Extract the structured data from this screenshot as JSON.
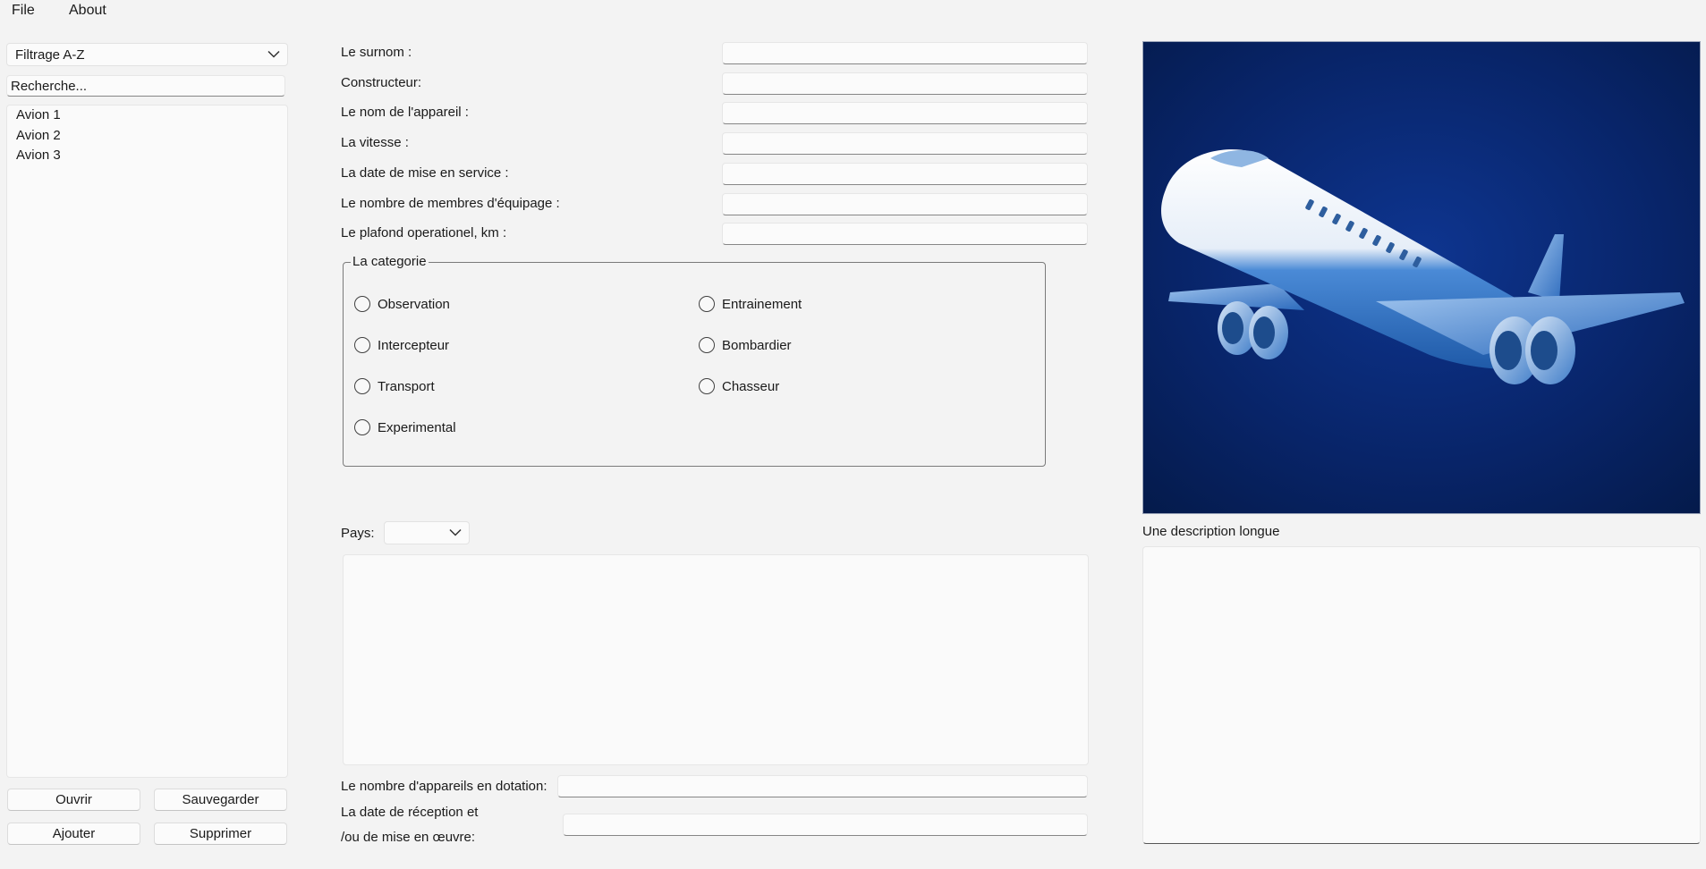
{
  "menu": {
    "file": "File",
    "about": "About"
  },
  "sidebar": {
    "sort_combo": "Filtrage A-Z",
    "search_placeholder": "Recherche...",
    "items": [
      "Avion 1",
      "Avion 2",
      "Avion 3"
    ],
    "buttons": {
      "open": "Ouvrir",
      "save": "Sauvegarder",
      "add": "Ajouter",
      "delete": "Supprimer"
    }
  },
  "form": {
    "nickname_label": "Le surnom :",
    "manufacturer_label": "Constructeur:",
    "aircraft_name_label": "Le nom de l'appareil :",
    "speed_label": "La vitesse :",
    "service_date_label": "La date de mise en service :",
    "crew_label": "Le nombre de membres d'équipage :",
    "ceiling_label": "Le plafond operationel, km :",
    "category": {
      "title": "La categorie",
      "options": [
        "Observation",
        "Entrainement",
        "Intercepteur",
        "Bombardier",
        "Transport",
        "Chasseur",
        "Experimental"
      ]
    },
    "country_label": "Pays:",
    "country_value": "",
    "count_label": "Le nombre d'appareils en dotation:",
    "reception_label_line1": "La date de réception et",
    "reception_label_line2": "/ou de mise en œuvre:"
  },
  "right": {
    "image_alt": "airplane-illustration",
    "description_label": "Une description longue"
  },
  "colors": {
    "background": "#f3f3f3",
    "image_bg_dark": "#041a4a",
    "image_bg_mid": "#0a2a78",
    "plane_blue": "#3a78c8",
    "plane_white": "#eef4fb"
  }
}
